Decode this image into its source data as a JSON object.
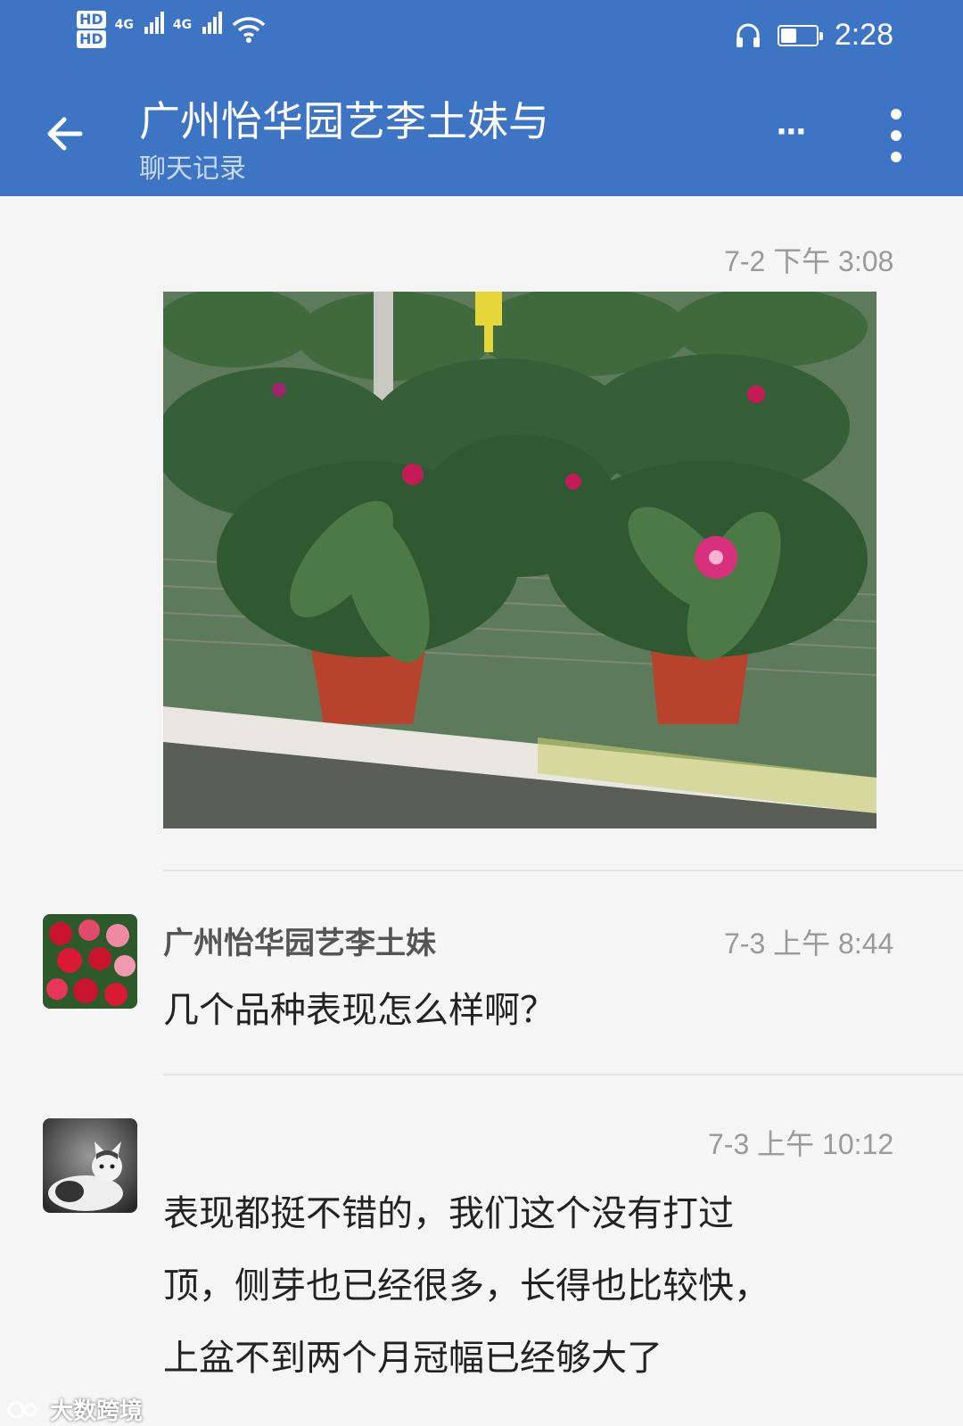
{
  "status_bar": {
    "sim1_badge": "HD",
    "sim2_badge": "HD",
    "network1": "4G",
    "network2": "4G",
    "time": "2:28",
    "battery_level": 0.45
  },
  "header": {
    "title": "广州怡华园艺李土妹与",
    "subtitle": "聊天记录"
  },
  "messages": [
    {
      "timestamp": "7-2  下午 3:08",
      "type": "image"
    },
    {
      "sender": "广州怡华园艺李土妹",
      "timestamp": "7-3  上午 8:44",
      "text": "几个品种表现怎么样啊？"
    },
    {
      "timestamp": "7-3  上午 10:12",
      "lines": [
        "表现都挺不错的，我们这个没有打过",
        "顶，侧芽也已经很多，长得也比较快，",
        "上盆不到两个月冠幅已经够大了"
      ]
    }
  ],
  "watermark": "大数跨境",
  "colors": {
    "header": "#3d74c4",
    "background": "#f5f5f5",
    "timestamp": "#9a9a9a"
  }
}
